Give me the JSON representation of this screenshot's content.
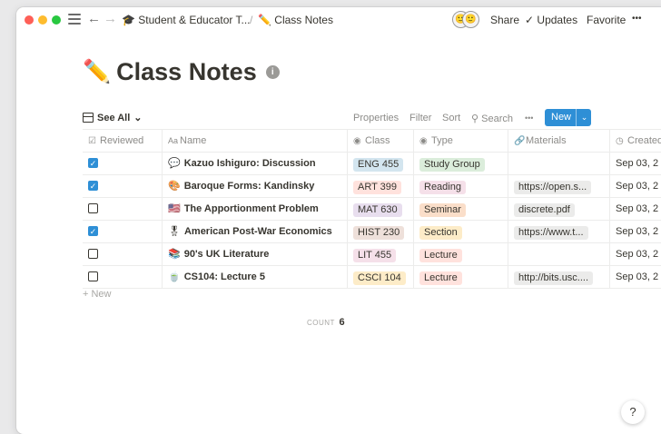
{
  "topbar": {
    "breadcrumb_parent": "Student & Educator T...",
    "breadcrumb_parent_emoji": "🎓",
    "breadcrumb_current": "Class Notes",
    "breadcrumb_current_emoji": "✏️",
    "share": "Share",
    "updates": "Updates",
    "favorite": "Favorite",
    "more": "•••",
    "back_arrow": "←",
    "forward_arrow": "→",
    "avatar_left": "🙂",
    "avatar_right": "🙂"
  },
  "page": {
    "title": "Class Notes",
    "title_emoji": "✏️",
    "info": "i"
  },
  "view": {
    "label": "See All",
    "chevron": "⌄",
    "properties": "Properties",
    "filter": "Filter",
    "sort": "Sort",
    "search_icon": "⚲",
    "search": "Search",
    "more": "•••",
    "new": "New",
    "new_chevron": "⌄"
  },
  "table": {
    "columns": [
      {
        "label": "Reviewed",
        "icon": "☑"
      },
      {
        "label": "Name",
        "icon": "Aa"
      },
      {
        "label": "Class",
        "icon": "◉"
      },
      {
        "label": "Type",
        "icon": "◉"
      },
      {
        "label": "Materials",
        "icon": "🔗"
      },
      {
        "label": "Created",
        "icon": "◷"
      }
    ],
    "rows": [
      {
        "reviewed": true,
        "emoji": "💬",
        "name": "Kazuo Ishiguro: Discussion",
        "class": "ENG 455",
        "type": "Study Group",
        "materials": "",
        "created": "Sep 03, 2"
      },
      {
        "reviewed": true,
        "emoji": "🎨",
        "name": "Baroque Forms: Kandinsky",
        "class": "ART 399",
        "type": "Reading",
        "materials": "https://open.s...",
        "created": "Sep 03, 2"
      },
      {
        "reviewed": false,
        "emoji": "🇺🇸",
        "name": "The Apportionment Problem",
        "class": "MAT 630",
        "type": "Seminar",
        "materials": "discrete.pdf",
        "created": "Sep 03, 2"
      },
      {
        "reviewed": true,
        "emoji": "🎖",
        "name": "American Post-War Economics",
        "class": "HIST 230",
        "type": "Section",
        "materials": "https://www.t...",
        "created": "Sep 03, 2"
      },
      {
        "reviewed": false,
        "emoji": "📚",
        "name": "90's UK Literature",
        "class": "LIT 455",
        "type": "Lecture",
        "materials": "",
        "created": "Sep 03, 2"
      },
      {
        "reviewed": false,
        "emoji": "🍵",
        "name": "CS104: Lecture 5",
        "class": "CSCI 104",
        "type": "Lecture",
        "materials": "http://bits.usc....",
        "created": "Sep 03, 2"
      }
    ],
    "new_row": "+ New",
    "count_label": "COUNT",
    "count_value": "6"
  },
  "help": "?",
  "colors": {
    "accent": "#2e8fd6",
    "tag_eng": "#d3e5ef",
    "tag_art": "#ffe2dd",
    "tag_mat": "#e8deee",
    "tag_hist": "#eee0da",
    "tag_lit": "#f5e0e9",
    "tag_csci": "#fdecc8",
    "type_study": "#dbeddb",
    "type_reading": "#f5e0e9",
    "type_seminar": "#fadec9",
    "type_section": "#fdecc8",
    "type_lecture": "#ffe2dd"
  }
}
